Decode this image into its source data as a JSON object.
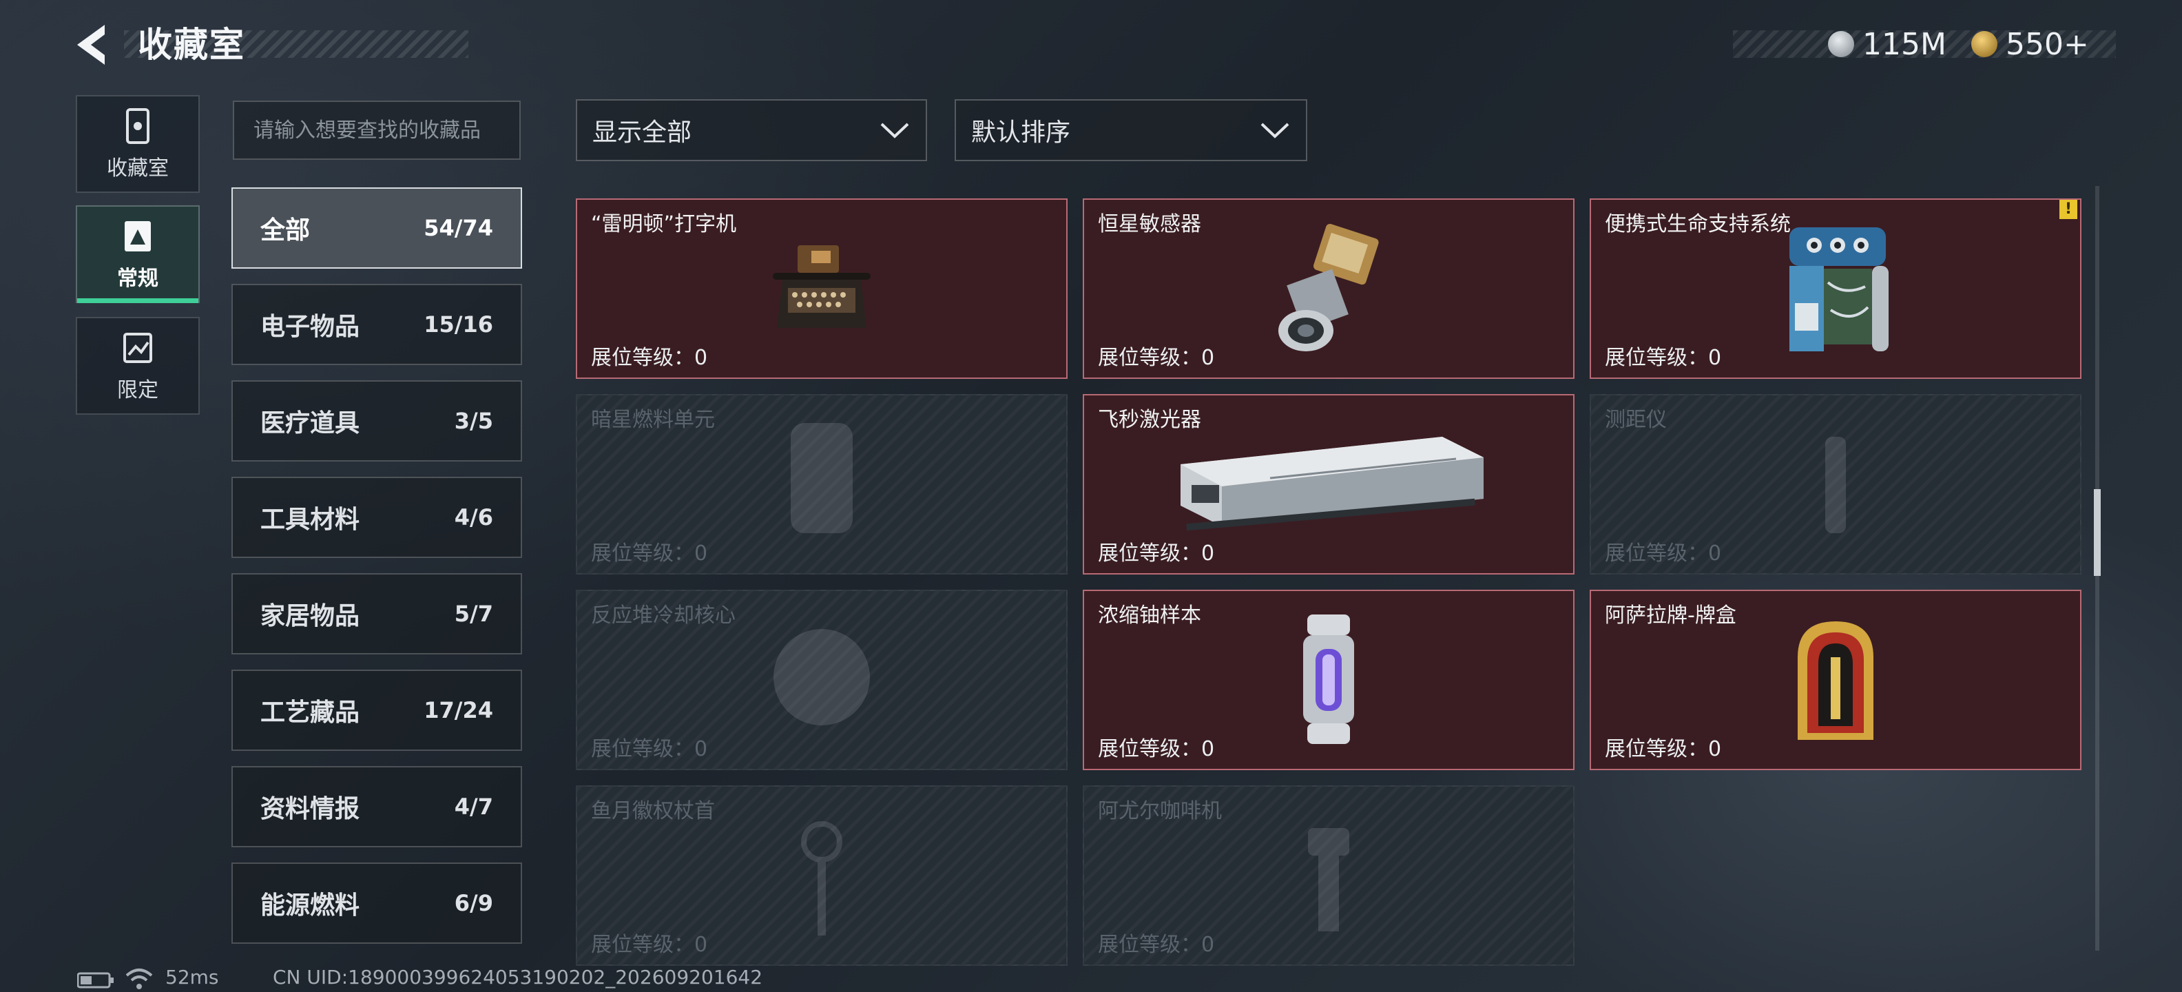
{
  "header": {
    "title": "收藏室",
    "currency": [
      {
        "icon": "silver-coin-icon",
        "value": "115M",
        "color": "#b9c0c7"
      },
      {
        "icon": "gold-triangle-coin-icon",
        "value": "550+",
        "color": "#d8a63a"
      }
    ]
  },
  "rail": [
    {
      "label": "收藏室",
      "icon": "collection-room-icon",
      "active": false
    },
    {
      "label": "常规",
      "icon": "regular-card-icon",
      "active": true
    },
    {
      "label": "限定",
      "icon": "limited-card-icon",
      "active": false
    }
  ],
  "search": {
    "placeholder": "请输入想要查找的收藏品"
  },
  "categories": [
    {
      "label": "全部",
      "count": "54/74",
      "active": true
    },
    {
      "label": "电子物品",
      "count": "15/16"
    },
    {
      "label": "医疗道具",
      "count": "3/5"
    },
    {
      "label": "工具材料",
      "count": "4/6"
    },
    {
      "label": "家居物品",
      "count": "5/7"
    },
    {
      "label": "工艺藏品",
      "count": "17/24"
    },
    {
      "label": "资料情报",
      "count": "4/7"
    },
    {
      "label": "能源燃料",
      "count": "6/9"
    }
  ],
  "filters": {
    "show": "显示全部",
    "sort": "默认排序"
  },
  "level_label": "展位等级：",
  "items": [
    {
      "name": "“雷明顿”打字机",
      "level": "0",
      "owned": true,
      "icon": "typewriter-icon"
    },
    {
      "name": "恒星敏感器",
      "level": "0",
      "owned": true,
      "icon": "star-sensor-icon"
    },
    {
      "name": "便携式生命支持系统",
      "level": "0",
      "owned": true,
      "icon": "life-support-icon",
      "warning": "!"
    },
    {
      "name": "暗星燃料单元",
      "level": "0",
      "owned": false,
      "icon": "fuel-cell-icon"
    },
    {
      "name": "飞秒激光器",
      "level": "0",
      "owned": true,
      "icon": "laser-icon"
    },
    {
      "name": "测距仪",
      "level": "0",
      "owned": false,
      "icon": "rangefinder-icon"
    },
    {
      "name": "反应堆冷却核心",
      "level": "0",
      "owned": false,
      "icon": "reactor-core-icon"
    },
    {
      "name": "浓缩铀样本",
      "level": "0",
      "owned": true,
      "icon": "uranium-capsule-icon"
    },
    {
      "name": "阿萨拉牌-牌盒",
      "level": "0",
      "owned": true,
      "icon": "card-box-icon"
    },
    {
      "name": "鱼月徽权杖首",
      "level": "0",
      "owned": false,
      "icon": "scepter-head-icon"
    },
    {
      "name": "阿尤尔咖啡机",
      "level": "0",
      "owned": false,
      "icon": "coffee-machine-icon"
    }
  ],
  "footer": {
    "ping": "52ms",
    "uid": "CN UID:189000399624053190202_202609201642"
  }
}
